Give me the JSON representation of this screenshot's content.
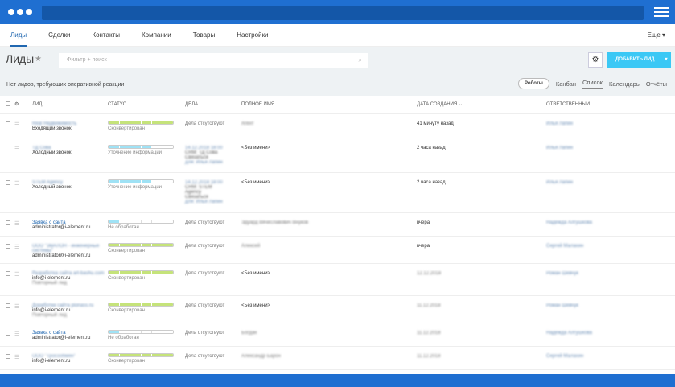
{
  "header": {
    "menu_icon": "three-dots-icon",
    "burger_icon": "hamburger-icon"
  },
  "nav": {
    "items": [
      "Лиды",
      "Сделки",
      "Контакты",
      "Компании",
      "Товары",
      "Настройки"
    ],
    "active": 0,
    "more": "Еще ▾"
  },
  "page": {
    "title": "Лиды",
    "star_icon": "★",
    "filter_placeholder": "Фильтр + поиск",
    "search_icon": "⌕",
    "settings_icon": "⚙",
    "add_button": "ДОБАВИТЬ ЛИД",
    "add_arrow": "▾"
  },
  "info": {
    "message": "Нет лидов, требующих оперативной реакции",
    "robots": "Роботы",
    "views": [
      "Канбан",
      "Список",
      "Календарь",
      "Отчёты"
    ],
    "active_view": "Список"
  },
  "columns": [
    "ЛИД",
    "СТАТУС",
    "ДЕЛА",
    "ПОЛНОЕ ИМЯ",
    "ДАТА СОЗДАНИЯ ⌄",
    "ОТВЕТСТВЕННЫЙ"
  ],
  "colors": {
    "converted": "#c5e37a",
    "progress": "#9fe2f5",
    "brand": "#1f6fd1",
    "add": "#3bc8f5"
  },
  "rows": [
    {
      "lead": "Real Недвижимость",
      "sub": [
        "Входящий звонок"
      ],
      "status": "Сконвертирован",
      "filled": 6,
      "kind": "converted",
      "deals": [
        "Дела отсутствуют"
      ],
      "name": "Агент",
      "date": "41 минуту назад",
      "resp": "Илья Лапин"
    },
    {
      "lead": "ТД Сова",
      "sub": [
        "Холодный звонок"
      ],
      "status": "Уточнение информации",
      "filled": 4,
      "kind": "progress",
      "deals": [
        "14.12.2018 18:00",
        "CRM: ТД Сова",
        "Связаться",
        "для: Илья Лапин"
      ],
      "name": "<Без имени>",
      "date": "2 часа назад",
      "resp": "Илья Лапин"
    },
    {
      "lead": "STEM Agency",
      "sub": [
        "Холодный звонок"
      ],
      "status": "Уточнение информации",
      "filled": 4,
      "kind": "progress",
      "deals": [
        "14.12.2018 18:00",
        "CRM: STEM",
        "Agency",
        "Связаться",
        "для: Илья Лапин"
      ],
      "name": "<Без имени>",
      "date": "2 часа назад",
      "resp": "Илья Лапин"
    },
    {
      "lead": "Заявка с сайта",
      "sub": [
        "administrator@i-element.ru"
      ],
      "status": "Не обработан",
      "filled": 1,
      "kind": "progress",
      "deals": [
        "Дела отсутствуют"
      ],
      "name": "Эдуард Вячеславович Внуков",
      "date": "вчера",
      "resp": "Надежда Алгушкова"
    },
    {
      "lead": "ООО \"ЭВАЛОН - инженерные системы\"",
      "sub": [
        "administrator@i-element.ru"
      ],
      "status": "Сконвертирован",
      "filled": 6,
      "kind": "converted",
      "deals": [
        "Дела отсутствуют"
      ],
      "name": "Алексей",
      "date": "вчера",
      "resp": "Сергей Малахин"
    },
    {
      "lead": "Разработка сайта art-bashu.com",
      "sub": [
        "info@i-element.ru",
        "Повторный лид"
      ],
      "status": "Сконвертирован",
      "filled": 6,
      "kind": "converted",
      "deals": [
        "Дела отсутствуют"
      ],
      "name": "<Без имени>",
      "date": "12.12.2018",
      "resp": "Роман Шевчук"
    },
    {
      "lead": "Доработки сайта pionass.ru",
      "sub": [
        "info@i-element.ru",
        "Повторный лид"
      ],
      "status": "Сконвертирован",
      "filled": 6,
      "kind": "converted",
      "deals": [
        "Дела отсутствуют"
      ],
      "name": "<Без имени>",
      "date": "11.12.2018",
      "resp": "Роман Шевчук"
    },
    {
      "lead": "Заявка с сайта",
      "sub": [
        "administrator@i-element.ru"
      ],
      "status": "Не обработан",
      "filled": 1,
      "kind": "progress",
      "deals": [
        "Дела отсутствуют"
      ],
      "name": "Богдан",
      "date": "11.12.2018",
      "resp": "Надежда Алгушкова"
    },
    {
      "lead": "ООО \"Тросообмен\"",
      "sub": [
        "info@i-element.ru"
      ],
      "status": "Сконвертирован",
      "filled": 6,
      "kind": "converted",
      "deals": [
        "Дела отсутствуют"
      ],
      "name": "Александр Барон",
      "date": "11.12.2018",
      "resp": "Сергей Малахин"
    }
  ]
}
